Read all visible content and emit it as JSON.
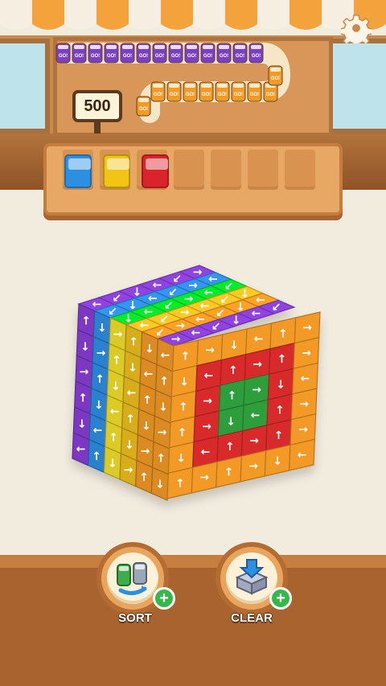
{
  "shop": {
    "price_label": "500",
    "can_label": "GO!",
    "box_colors": [
      "#2d8fe0",
      "#f2c414",
      "#d9242b"
    ],
    "awning_colors": [
      "#f6efe1",
      "#f3a23c"
    ]
  },
  "settings": {
    "icon": "gear-icon"
  },
  "cube": {
    "arrow_glyph": "↑",
    "stripe_colors": [
      "#8a3fd8",
      "#2e8fe6",
      "#f4e22a",
      "#f0c020",
      "#f39a25"
    ],
    "front_rings": [
      "#f39a25",
      "#d82a2a",
      "#2f9e3c"
    ]
  },
  "buttons": {
    "sort": {
      "label": "SORT",
      "plus": "+",
      "icon": "cans-swap-icon"
    },
    "clear": {
      "label": "CLEAR",
      "plus": "+",
      "icon": "clear-tray-icon"
    }
  }
}
